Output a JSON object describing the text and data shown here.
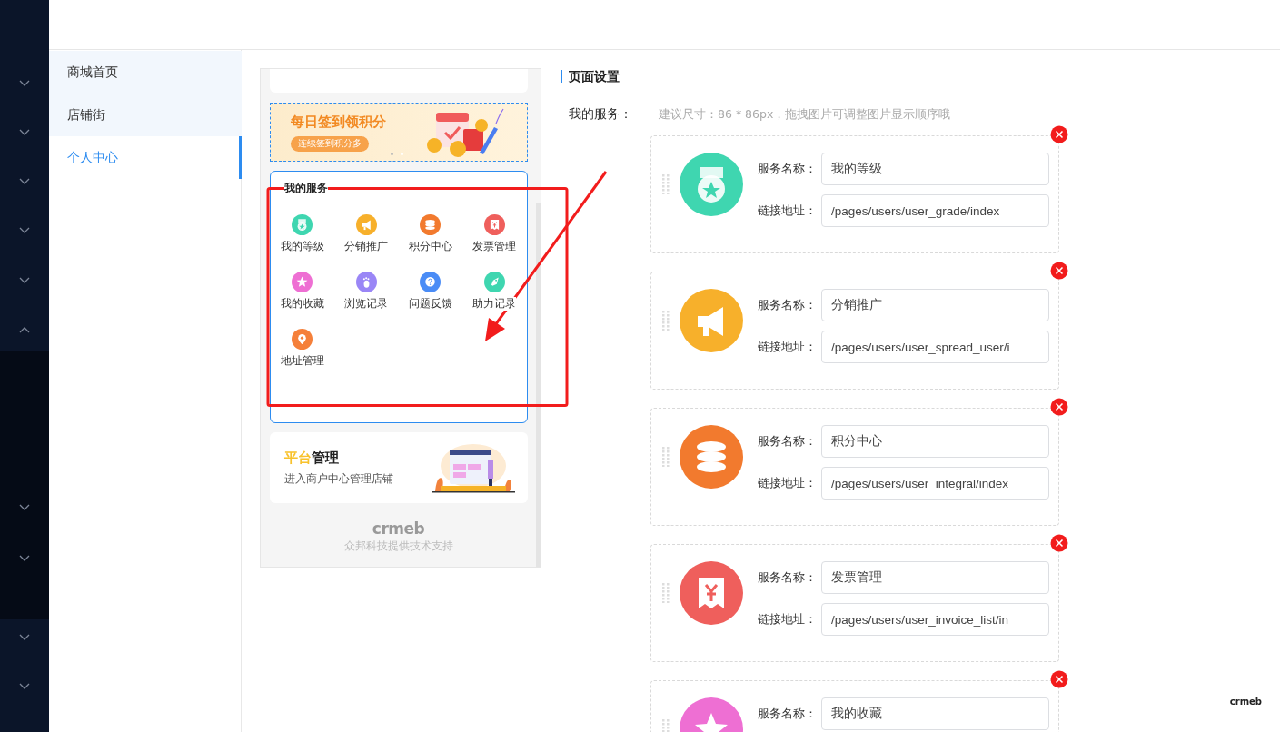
{
  "rail": {
    "chevrons": [
      {
        "expanded": false
      },
      {
        "expanded": false
      },
      {
        "expanded": false
      },
      {
        "expanded": false
      },
      {
        "expanded": false
      },
      {
        "expanded": true
      },
      {
        "expanded": false
      },
      {
        "expanded": false
      },
      {
        "expanded": false
      },
      {
        "expanded": false
      }
    ]
  },
  "subnav": {
    "items": [
      {
        "label": "商城首页",
        "selected": false
      },
      {
        "label": "店铺街",
        "selected": false
      },
      {
        "label": "个人中心",
        "selected": true
      }
    ]
  },
  "preview": {
    "banner": {
      "title": "每日签到领积分",
      "pill": "连续签到积分多"
    },
    "services": {
      "title": "我的服务",
      "selected": true,
      "items": [
        {
          "label": "我的等级",
          "color": "#3fd6b0"
        },
        {
          "label": "分销推广",
          "color": "#f7b02b"
        },
        {
          "label": "积分中心",
          "color": "#f27a2e"
        },
        {
          "label": "发票管理",
          "color": "#ef5f5c"
        },
        {
          "label": "我的收藏",
          "color": "#ee6fd3"
        },
        {
          "label": "浏览记录",
          "color": "#9a86f6"
        },
        {
          "label": "问题反馈",
          "color": "#4a8cf6"
        },
        {
          "label": "助力记录",
          "color": "#3fd6b0"
        },
        {
          "label": "地址管理",
          "color": "#f5803a"
        }
      ]
    },
    "platform": {
      "title_highlight": "平台",
      "title_rest": "管理",
      "subtitle": "进入商户中心管理店铺"
    },
    "footer": {
      "logo": "crmeb",
      "text": "众邦科技提供技术支持"
    }
  },
  "settings": {
    "title": "页面设置",
    "field_label": "我的服务：",
    "hint": "建议尺寸：86 * 86px，拖拽图片可调整图片显示顺序哦",
    "cards": [
      {
        "name_label": "服务名称：",
        "name": "我的等级",
        "link_label": "链接地址：",
        "link": "/pages/users/user_grade/index",
        "color": "#3fd6b0"
      },
      {
        "name_label": "服务名称：",
        "name": "分销推广",
        "link_label": "链接地址：",
        "link": "/pages/users/user_spread_user/i",
        "color": "#f7b02b"
      },
      {
        "name_label": "服务名称：",
        "name": "积分中心",
        "link_label": "链接地址：",
        "link": "/pages/users/user_integral/index",
        "color": "#f27a2e"
      },
      {
        "name_label": "服务名称：",
        "name": "发票管理",
        "link_label": "链接地址：",
        "link": "/pages/users/user_invoice_list/in",
        "color": "#ef5f5c"
      },
      {
        "name_label": "服务名称：",
        "name": "我的收藏",
        "color": "#ee6fd3"
      }
    ]
  },
  "corner_logo": "crmeb"
}
